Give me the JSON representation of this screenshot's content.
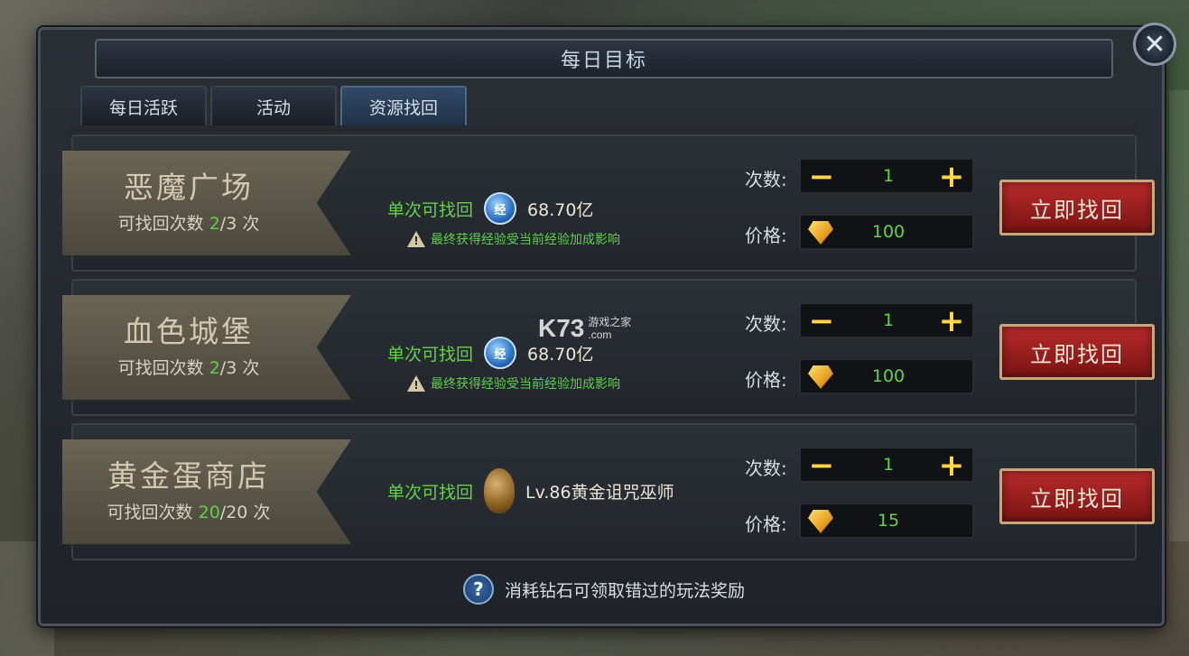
{
  "window": {
    "title": "每日目标",
    "close_icon": "close-icon"
  },
  "tabs": [
    {
      "label": "每日活跃",
      "active": false
    },
    {
      "label": "活动",
      "active": false
    },
    {
      "label": "资源找回",
      "active": true
    }
  ],
  "labels": {
    "count": "次数:",
    "price": "价格:",
    "recover_once": "单次可找回",
    "recoverable_prefix": "可找回次数",
    "times_suffix": "次",
    "action": "立即找回",
    "minus": "−",
    "plus": "+",
    "exp_icon_text": "经"
  },
  "rows": [
    {
      "name": "恶魔广场",
      "current": "2",
      "total": "/3",
      "reward_type": "exp",
      "reward_value": "68.70亿",
      "note": "最终获得经验受当前经验加成影响",
      "count": "1",
      "price": "100"
    },
    {
      "name": "血色城堡",
      "current": "2",
      "total": "/3",
      "reward_type": "exp",
      "reward_value": "68.70亿",
      "note": "最终获得经验受当前经验加成影响",
      "count": "1",
      "price": "100"
    },
    {
      "name": "黄金蛋商店",
      "current": "20",
      "total": "/20",
      "reward_type": "egg",
      "reward_value": "Lv.86黄金诅咒巫师",
      "note": "",
      "count": "1",
      "price": "15"
    }
  ],
  "footer": {
    "text": "消耗钻石可领取错过的玩法奖励",
    "help_icon_text": "?"
  },
  "watermark": {
    "big": "K73",
    "small_top": "游戏之家",
    "small_bottom": ".com"
  },
  "colors": {
    "highlight_green": "#63d248",
    "button_red": "#b82a2a",
    "gold": "#ffd84a"
  }
}
